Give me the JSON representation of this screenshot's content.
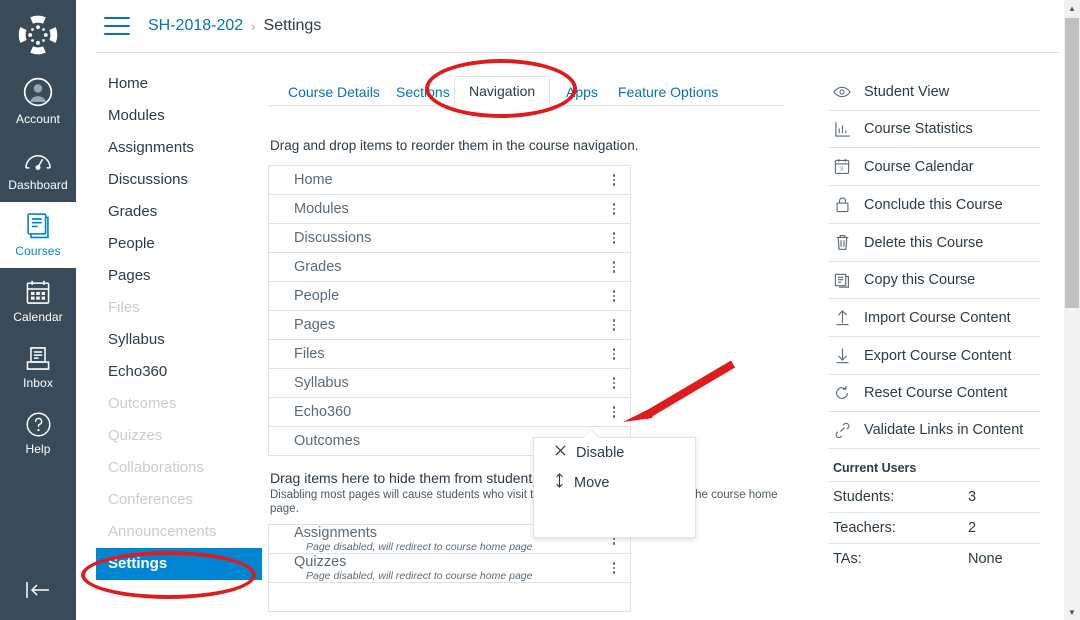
{
  "global_nav": {
    "logo_name": "canvas-logo",
    "items": [
      {
        "label": "Account",
        "icon": "user-circle-icon",
        "active": false
      },
      {
        "label": "Dashboard",
        "icon": "dashboard-gauge-icon",
        "active": false
      },
      {
        "label": "Courses",
        "icon": "courses-book-icon",
        "active": true
      },
      {
        "label": "Calendar",
        "icon": "calendar-icon",
        "active": false
      },
      {
        "label": "Inbox",
        "icon": "inbox-tray-icon",
        "active": false
      },
      {
        "label": "Help",
        "icon": "question-circle-icon",
        "active": false
      }
    ],
    "collapse_label": "collapse-nav-icon"
  },
  "breadcrumb": {
    "menu_icon": "hamburger-menu-icon",
    "course": "SH-2018-202",
    "separator": "›",
    "current": "Settings"
  },
  "course_nav": {
    "items": [
      {
        "label": "Home",
        "state": "normal"
      },
      {
        "label": "Modules",
        "state": "normal"
      },
      {
        "label": "Assignments",
        "state": "normal"
      },
      {
        "label": "Discussions",
        "state": "normal"
      },
      {
        "label": "Grades",
        "state": "normal"
      },
      {
        "label": "People",
        "state": "normal"
      },
      {
        "label": "Pages",
        "state": "normal"
      },
      {
        "label": "Files",
        "state": "dim"
      },
      {
        "label": "Syllabus",
        "state": "normal"
      },
      {
        "label": "Echo360",
        "state": "normal"
      },
      {
        "label": "Outcomes",
        "state": "dim"
      },
      {
        "label": "Quizzes",
        "state": "dim"
      },
      {
        "label": "Collaborations",
        "state": "dim"
      },
      {
        "label": "Conferences",
        "state": "dim"
      },
      {
        "label": "Announcements",
        "state": "dim"
      },
      {
        "label": "Settings",
        "state": "active"
      }
    ]
  },
  "tabs": [
    {
      "label": "Course Details",
      "selected": false
    },
    {
      "label": "Sections",
      "selected": false
    },
    {
      "label": "Navigation",
      "selected": true
    },
    {
      "label": "Apps",
      "selected": false
    },
    {
      "label": "Feature Options",
      "selected": false
    }
  ],
  "main": {
    "reorder_help": "Drag and drop items to reorder them in the course navigation.",
    "visible_items": [
      {
        "label": "Home"
      },
      {
        "label": "Modules"
      },
      {
        "label": "Discussions"
      },
      {
        "label": "Grades"
      },
      {
        "label": "People"
      },
      {
        "label": "Pages"
      },
      {
        "label": "Files"
      },
      {
        "label": "Syllabus"
      },
      {
        "label": "Echo360"
      },
      {
        "label": "Outcomes"
      }
    ],
    "hidden_heading": "Drag items here to hide them from students.",
    "hidden_subtext": "Disabling most pages will cause students who visit those pages to be redirected to the course home page.",
    "hidden_items": [
      {
        "label": "Assignments",
        "sub": "Page disabled, will redirect to course home page"
      },
      {
        "label": "Quizzes",
        "sub": "Page disabled, will redirect to course home page"
      }
    ],
    "kebab_icon": "kebab-menu-icon"
  },
  "popup_menu": {
    "items": [
      {
        "label": "Disable",
        "icon": "close-x-icon"
      },
      {
        "label": "Move",
        "icon": "move-updown-arrow-icon"
      }
    ]
  },
  "right_sidebar": {
    "buttons": [
      {
        "label": "Student View",
        "icon": "eye-icon"
      },
      {
        "label": "Course Statistics",
        "icon": "stats-chart-icon"
      },
      {
        "label": "Course Calendar",
        "icon": "calendar-icon"
      },
      {
        "label": "Conclude this Course",
        "icon": "lock-icon"
      },
      {
        "label": "Delete this Course",
        "icon": "trash-icon"
      },
      {
        "label": "Copy this Course",
        "icon": "copy-document-icon"
      },
      {
        "label": "Import Course Content",
        "icon": "arrow-up-import-icon"
      },
      {
        "label": "Export Course Content",
        "icon": "arrow-down-export-icon"
      },
      {
        "label": "Reset Course Content",
        "icon": "refresh-circle-icon"
      },
      {
        "label": "Validate Links in Content",
        "icon": "link-chain-icon"
      }
    ],
    "current_users_title": "Current Users",
    "user_rows": [
      {
        "key": "Students:",
        "value": "3"
      },
      {
        "key": "Teachers:",
        "value": "2"
      },
      {
        "key": "TAs:",
        "value": "None"
      }
    ]
  },
  "annotations": {
    "ellipse_navigation_tab": "red-ellipse-navigation-tab",
    "ellipse_settings_nav": "red-ellipse-settings-nav",
    "arrow_kebab": "red-arrow-echo360-kebab",
    "color": "#e01b1b"
  },
  "scrollbar": {
    "up_glyph": "▲",
    "down_glyph": "▼"
  }
}
